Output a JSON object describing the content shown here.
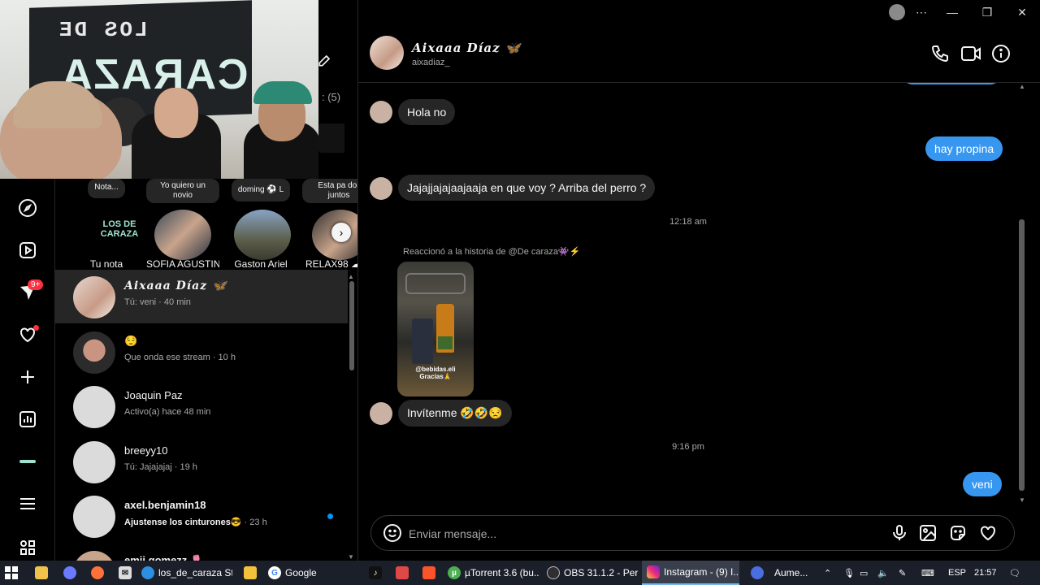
{
  "webcam": {
    "banner_line1": "LOS DE",
    "banner_line2": "CARAZA"
  },
  "notes_bar": {
    "items": [
      {
        "bubble": "Nota...",
        "name": "Tu nota",
        "logo": "LOS DE CARAZA"
      },
      {
        "bubble": "Yo quiero un novio",
        "name": "SOFIA AGUSTIN..."
      },
      {
        "bubble": "doming ⚽ L",
        "name": "Gaston Ariel"
      },
      {
        "bubble": "Esta pa dor juntos",
        "name": "RELAX98 ☁ ≡"
      }
    ]
  },
  "requests_label": ": (5)",
  "badges": {
    "notifications": "9+"
  },
  "conversations": [
    {
      "name": "Aixaaa Díaz 🦋",
      "fancy": true,
      "subtitle": "Tú: veni · 40 min",
      "active": true
    },
    {
      "name": "😌",
      "subtitle": "Que onda ese stream · 10 h"
    },
    {
      "name": "Joaquin Paz",
      "subtitle": "Activo(a) hace 48 min"
    },
    {
      "name": "breeyy10",
      "subtitle": "Tú: Jajajajaj · 19 h"
    },
    {
      "name": "axel.benjamin18",
      "subtitle_bold": "Ajustense los cinturones😎",
      "subtitle_time": " · 23 h",
      "unread": true
    },
    {
      "name": "emii.gomezz 🌷",
      "subtitle": ""
    }
  ],
  "chat": {
    "name": "Aixaaa Díaz 🦋",
    "username": "aixadiaz_",
    "messages": {
      "m1": "Hola no",
      "m2": "hay propina",
      "m3": "Jajajjajajaajaaja en que voy ? Arriba del perro ?",
      "time1": "12:18 am",
      "story_label": "Reaccionó a la historia de @De caraza👾⚡",
      "story_caption": "@bebidas.eli Gracias🙏",
      "m4": "Invítenme 🤣🤣😒",
      "time2": "9:16 pm",
      "m5": "veni"
    },
    "composer_placeholder": "Enviar mensaje..."
  },
  "taskbar": {
    "items": [
      {
        "label": "los_de_caraza St...",
        "icon": "edge-icon"
      },
      {
        "label": "Google",
        "icon": "chrome-icon"
      },
      {
        "label": "µTorrent 3.6 (bu...",
        "icon": "utorrent-icon"
      },
      {
        "label": "OBS 31.1.2 - Per...",
        "icon": "obs-icon"
      },
      {
        "label": "Instagram - (9) I...",
        "icon": "instagram-icon"
      },
      {
        "label": "Aume...",
        "icon": "thermometer-icon"
      }
    ],
    "lang": "ESP",
    "clock": "21:57"
  },
  "colors": {
    "accent": "#3797f0",
    "bubble_in": "#262626",
    "badge": "#ff3040",
    "unread_dot": "#0095f6"
  }
}
